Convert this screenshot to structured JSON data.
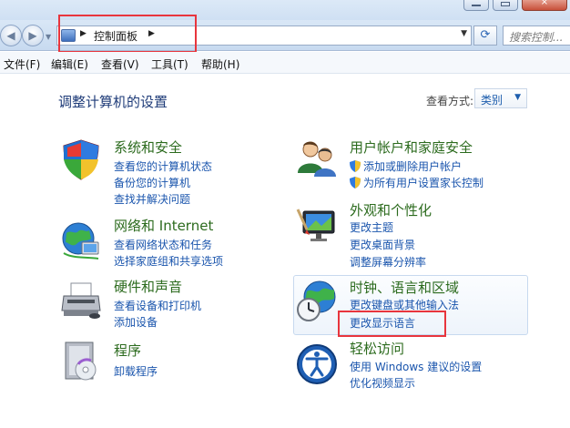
{
  "window": {
    "close_glyph": "×"
  },
  "address": {
    "crumb": "控制面板",
    "search_placeholder": "搜索控制..."
  },
  "menu": {
    "items": [
      "文件(F)",
      "编辑(E)",
      "查看(V)",
      "工具(T)",
      "帮助(H)"
    ]
  },
  "page": {
    "title": "调整计算机的设置",
    "view_by_label": "查看方式:",
    "view_by_value": "类别"
  },
  "categories": {
    "system": {
      "title": "系统和安全",
      "links": [
        "查看您的计算机状态",
        "备份您的计算机",
        "查找并解决问题"
      ]
    },
    "network": {
      "title": "网络和 Internet",
      "links": [
        "查看网络状态和任务",
        "选择家庭组和共享选项"
      ]
    },
    "hardware": {
      "title": "硬件和声音",
      "links": [
        "查看设备和打印机",
        "添加设备"
      ]
    },
    "programs": {
      "title": "程序",
      "links": [
        "卸载程序"
      ]
    },
    "users": {
      "title": "用户帐户和家庭安全",
      "links": [
        "添加或删除用户帐户",
        "为所有用户设置家长控制"
      ]
    },
    "appearance": {
      "title": "外观和个性化",
      "links": [
        "更改主题",
        "更改桌面背景",
        "调整屏幕分辨率"
      ]
    },
    "clock": {
      "title": "时钟、语言和区域",
      "links": [
        "更改键盘或其他输入法",
        "更改显示语言"
      ]
    },
    "ease": {
      "title": "轻松访问",
      "links": [
        "使用 Windows 建议的设置",
        "优化视频显示"
      ]
    }
  },
  "colors": {
    "title_green": "#2c6b1e",
    "link_blue": "#1a55ad",
    "highlight_red": "#e8353d"
  },
  "icons": [
    "shield-icon",
    "network-globe-icon",
    "printer-icon",
    "programs-icon",
    "users-icon",
    "paint-monitor-icon",
    "clock-globe-icon",
    "ease-of-access-icon"
  ]
}
